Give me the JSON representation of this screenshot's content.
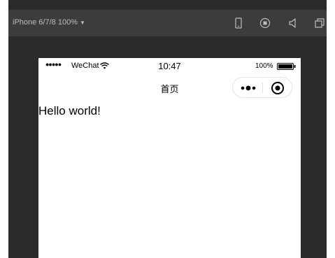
{
  "toolbar": {
    "device_label": "iPhone 6/7/8 100%",
    "caret_icon": "caret-down-icon",
    "icons": [
      "phone-icon",
      "record-icon",
      "sound-icon",
      "window-icon"
    ]
  },
  "phone": {
    "status_bar": {
      "signal": "●●●●●",
      "carrier": "WeChat",
      "time": "10:47",
      "battery_percent": "100%"
    },
    "nav": {
      "title": "首页"
    },
    "content": {
      "text": "Hello world!"
    }
  },
  "colors": {
    "workspace": "#2b2b2b",
    "toolbar": "#3c3c3c",
    "phone_screen": "#ffffff"
  }
}
